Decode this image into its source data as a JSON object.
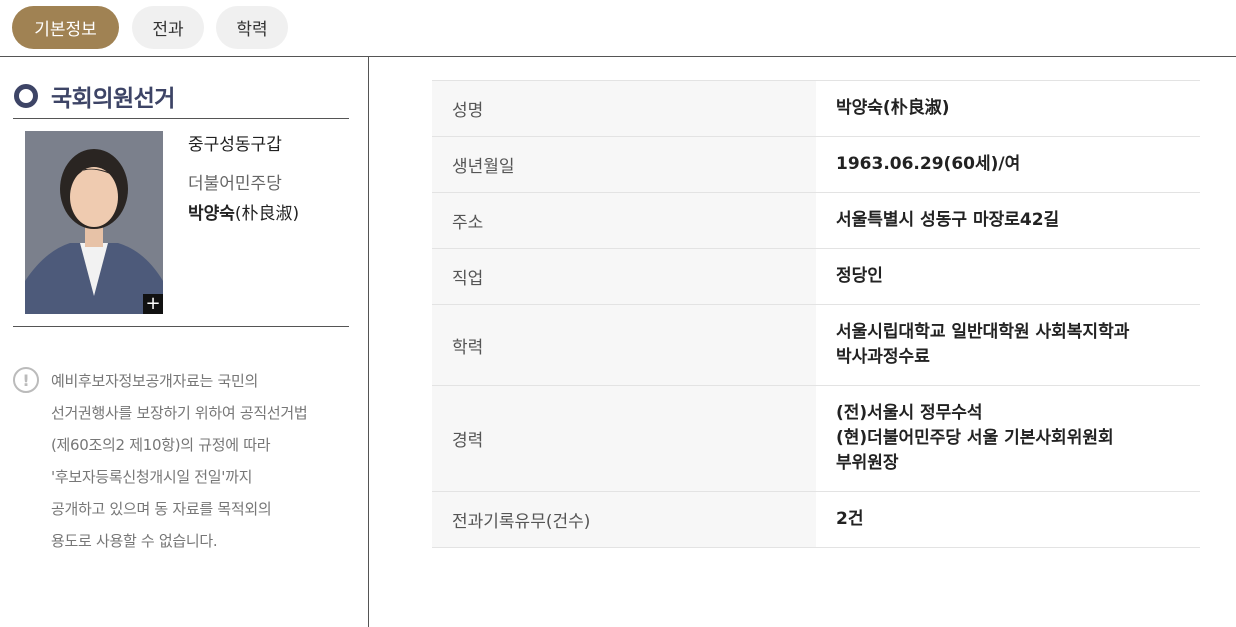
{
  "tabs": [
    {
      "label": "기본정보",
      "active": true
    },
    {
      "label": "전과",
      "active": false
    },
    {
      "label": "학력",
      "active": false
    }
  ],
  "section": {
    "title": "국회의원선거"
  },
  "candidate": {
    "district": "중구성동구갑",
    "party": "더불어민주당",
    "name_korean": "박양숙",
    "name_hanja": "(朴良淑)",
    "photo_expand_icon": "+"
  },
  "notice": {
    "icon": "!",
    "lines": [
      "예비후보자정보공개자료는 국민의",
      "선거권행사를 보장하기 위하여 공직선거법",
      "(제60조의2 제10항)의 규정에 따라",
      "'후보자등록신청개시일 전일'까지",
      "공개하고 있으며 동 자료를 목적외의",
      "용도로 사용할 수 없습니다."
    ]
  },
  "details": [
    {
      "label": "성명",
      "value": [
        "박양숙(朴良淑)"
      ]
    },
    {
      "label": "생년월일",
      "value": [
        "1963.06.29(60세)/여"
      ]
    },
    {
      "label": "주소",
      "value": [
        "서울특별시 성동구 마장로42길"
      ]
    },
    {
      "label": "직업",
      "value": [
        "정당인"
      ]
    },
    {
      "label": "학력",
      "value": [
        "서울시립대학교 일반대학원 사회복지학과",
        "박사과정수료"
      ]
    },
    {
      "label": "경력",
      "value": [
        "(전)서울시 정무수석",
        "(현)더불어민주당 서울 기본사회위원회",
        "부위원장"
      ]
    },
    {
      "label": "전과기록유무(건수)",
      "value": [
        "2건"
      ]
    }
  ],
  "colors": {
    "active_tab": "#a08253",
    "title": "#3d4466"
  }
}
